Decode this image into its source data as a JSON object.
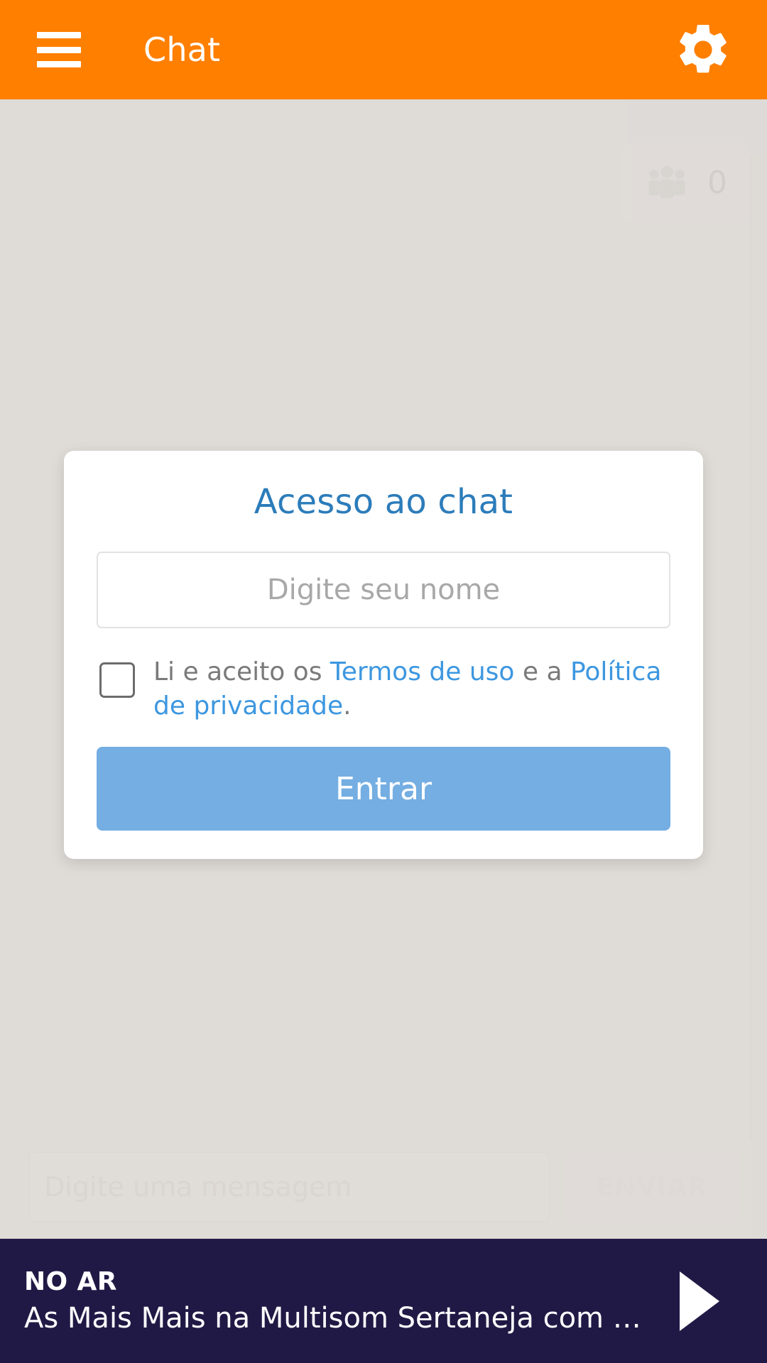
{
  "header": {
    "menu_icon": "hamburger-menu-icon",
    "title": "Chat",
    "settings_icon": "gear-icon"
  },
  "chat": {
    "users_icon": "users-group-icon",
    "users_count": "0",
    "composer": {
      "placeholder": "Digite uma mensagem",
      "value": "",
      "send_label": "ENVIAR"
    }
  },
  "modal": {
    "title": "Acesso ao chat",
    "name_input": {
      "placeholder": "Digite seu nome",
      "value": ""
    },
    "terms": {
      "prefix": "Li e aceito os ",
      "link_terms": "Termos de uso",
      "middle": " e a ",
      "link_privacy": "Política de privacidade",
      "suffix": "."
    },
    "submit_label": "Entrar",
    "checkbox_checked": false
  },
  "player": {
    "status": "NO AR",
    "now_playing": "As Mais Mais na Multisom Sertaneja com Al...",
    "play_icon": "play-icon"
  },
  "colors": {
    "brand_orange": "#ff7f00",
    "page_background": "#dedad6",
    "modal_title_blue": "#2c7cba",
    "link_blue": "#3d97e0",
    "button_blue": "#74aee2",
    "player_background": "#211945"
  }
}
